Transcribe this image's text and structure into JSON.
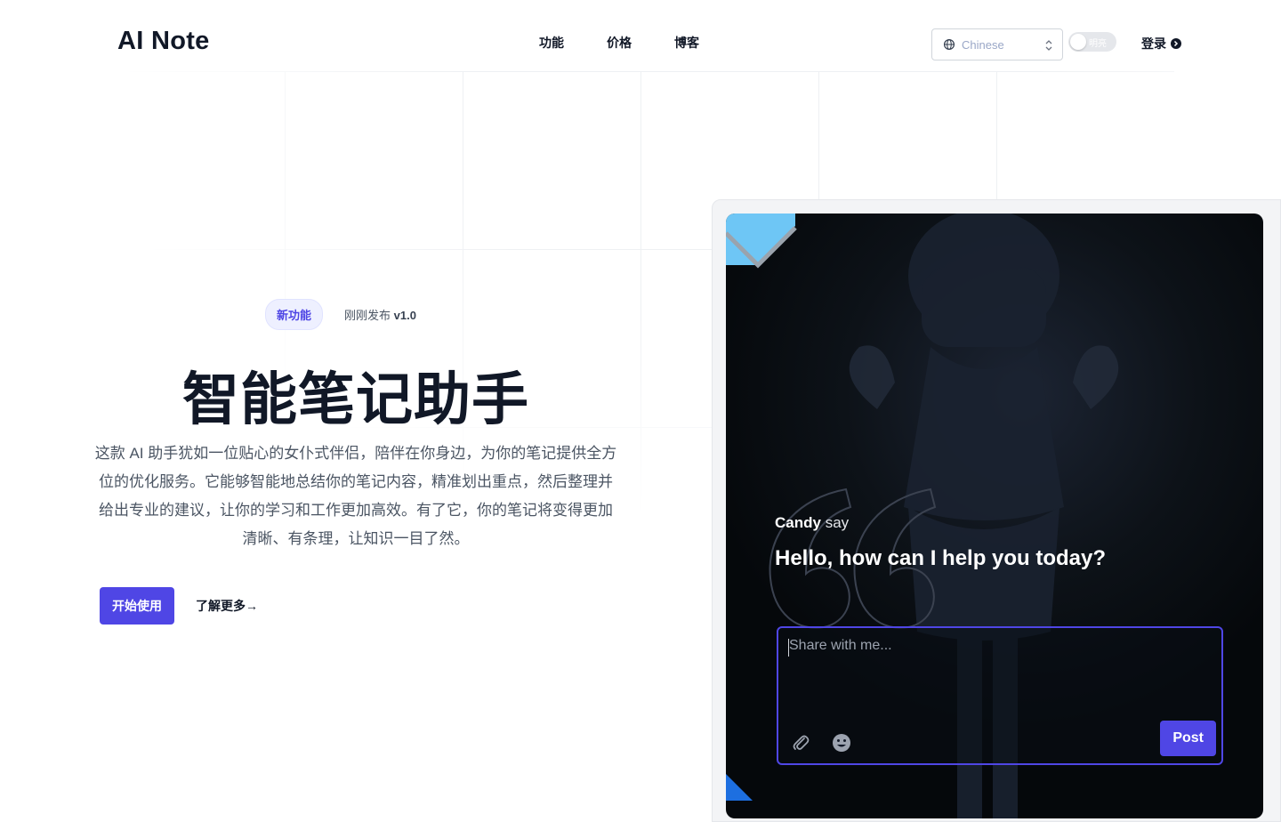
{
  "header": {
    "logo": "AI Note",
    "nav": [
      {
        "label": "功能"
      },
      {
        "label": "价格"
      },
      {
        "label": "博客"
      }
    ],
    "language": {
      "value": "Chinese"
    },
    "theme_toggle": {
      "label": "明亮"
    },
    "login_label": "登录"
  },
  "hero": {
    "badge": "新功能",
    "release_text": "刚刚发布",
    "release_version": "v1.0",
    "title": "智能笔记助手",
    "description": "这款 AI 助手犹如一位贴心的女仆式伴侣，陪伴在你身边，为你的笔记提供全方位的优化服务。它能够智能地总结你的笔记内容，精准划出重点，然后整理并给出专业的建议，让你的学习和工作更加高效。有了它，你的笔记将变得更加清晰、有条理，让知识一目了然。",
    "primary_cta": "开始使用",
    "secondary_cta": "了解更多→"
  },
  "mockup": {
    "speaker": "Candy",
    "speaker_suffix": "say",
    "greeting": "Hello, how can I help you today?",
    "input_placeholder": "Share with me...",
    "post_label": "Post"
  },
  "colors": {
    "accent": "#4f46e5",
    "badge_bg": "#eef0ff",
    "card_bg": "#0d1218",
    "corner_blue": "#6ec6f5"
  },
  "icons": [
    "globe-icon",
    "chevron-updown-icon",
    "arrow-right-circle-icon",
    "paperclip-icon",
    "smile-icon",
    "quote-icon"
  ]
}
